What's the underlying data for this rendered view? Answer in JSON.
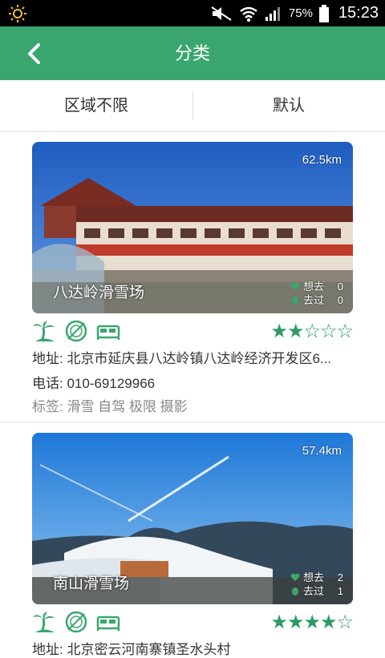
{
  "status_bar": {
    "battery": "75%",
    "time": "15:23"
  },
  "header": {
    "title": "分类"
  },
  "filters": {
    "region": "区域不限",
    "sort": "默认"
  },
  "colors": {
    "brand": "#3aa66e",
    "star": "#2e9a66"
  },
  "places": [
    {
      "distance": "62.5km",
      "name": "八达岭滑雪场",
      "want_label": "想去",
      "want_count": "0",
      "been_label": "去过",
      "been_count": "0",
      "rating": 2,
      "stars": "★★☆☆☆",
      "address": "地址: 北京市延庆县八达岭镇八达岭经济开发区6...",
      "phone": "电话: 010-69129966",
      "tags": "标签: 滑雪 自驾 极限 摄影",
      "icons": [
        "palm-tree-icon",
        "dining-icon",
        "bed-icon"
      ]
    },
    {
      "distance": "57.4km",
      "name": "南山滑雪场",
      "want_label": "想去",
      "want_count": "2",
      "been_label": "去过",
      "been_count": "1",
      "rating": 4,
      "stars": "★★★★☆",
      "address": "地址: 北京密云河南寨镇圣水头村",
      "icons": [
        "palm-tree-icon",
        "dining-icon",
        "bed-icon"
      ]
    }
  ]
}
